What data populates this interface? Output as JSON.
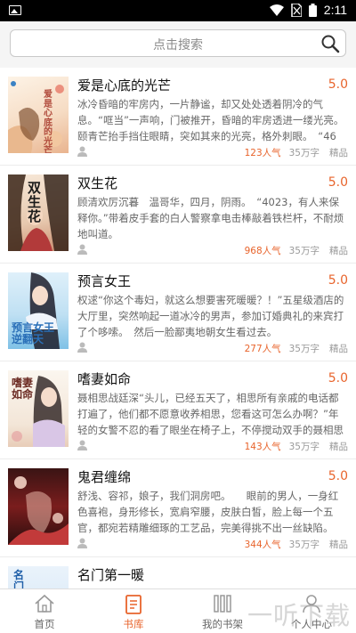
{
  "status_bar": {
    "time": "2:11"
  },
  "search": {
    "placeholder": "点击搜索"
  },
  "books": [
    {
      "title": "爱是心底的光芒",
      "score": "5.0",
      "description": "冰冷昏暗的牢房内，一片静谧，却又处处透着阴冷的气息。“哐当”一声响，门被推开，昏暗的牢房透进一缕光亮。　颐青芒抬手挡住眼睛，突如其来的光亮，格外刺眼。　“46号犯人",
      "popularity": "123人气",
      "words": "35万字",
      "tag": "精品",
      "cover_text": "爱是心底的光芒"
    },
    {
      "title": "双生花",
      "score": "5.0",
      "description": "顾清欢厉沉暮　温哥华，四月，阴雨。　“4023，有人来保释你。”带着皮手套的白人警察拿电击棒敲着铁栏杆，不耐烦地叫道。",
      "popularity": "968人气",
      "words": "35万字",
      "tag": "精品",
      "cover_text": "双生花"
    },
    {
      "title": "预言女王",
      "score": "5.0",
      "description": "权逑“你这个毒妇，就这么想要害死暖暖？！”五星级酒店的大厅里，突然响起一道冰冷的男声，参加订婚典礼的来宾打了个哆嗦。　然后一脸鄙夷地朝女生看过去。",
      "popularity": "277人气",
      "words": "35万字",
      "tag": "精品",
      "cover_text": "预言女王　逆翻天"
    },
    {
      "title": "嗜妻如命",
      "score": "5.0",
      "description": "聂相思战廷深“头儿，已经五天了，相思所有亲戚的电话都打遍了，他们都不愿意收养相思，您看这可怎么办啊？”年轻的女警不忍的看了眼坐在椅子上，不停搅动双手的聂相思道，“还能怎",
      "popularity": "143人气",
      "words": "35万字",
      "tag": "精品",
      "cover_text": "嗜妻如命"
    },
    {
      "title": "鬼君缠绵",
      "score": "5.0",
      "description": "舒浅、容祁，娘子，我们洞房吧。　　眼前的男人，一身红色喜袍，身形修长，宽肩窄腰，皮肤白皙，脸上每一个五官，都宛若精雕细琢的工艺品，完美得挑不出一丝缺陷。",
      "popularity": "344人气",
      "words": "35万字",
      "tag": "精品",
      "cover_text": ""
    },
    {
      "title": "名门第一暖",
      "score": "",
      "description": "",
      "popularity": "",
      "words": "",
      "tag": "",
      "cover_text": "名门"
    }
  ],
  "tabs": [
    {
      "label": "首页",
      "icon": "home-icon",
      "active": false
    },
    {
      "label": "书库",
      "icon": "library-icon",
      "active": true
    },
    {
      "label": "我的书架",
      "icon": "bookshelf-icon",
      "active": false
    },
    {
      "label": "个人中心",
      "icon": "person-icon",
      "active": false
    }
  ],
  "watermark": "一听下载",
  "colors": {
    "accent": "#e8642c",
    "text": "#111111",
    "muted": "#666666"
  }
}
